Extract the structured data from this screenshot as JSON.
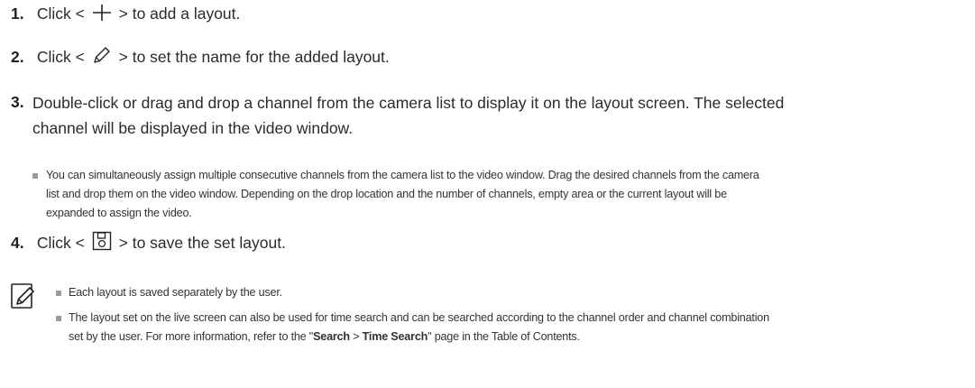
{
  "steps": [
    {
      "number": "1.",
      "before": "Click <",
      "after": "> to add a layout.",
      "icon": "plus-icon"
    },
    {
      "number": "2.",
      "before": "Click <",
      "after": "> to set the name for the added layout.",
      "icon": "pencil-icon"
    },
    {
      "number": "3.",
      "line1": "Double-click or drag and drop a channel from the camera list to display it on the layout screen. The selected",
      "line2": "channel will be displayed in the video window."
    },
    {
      "number": "4.",
      "before": "Click <",
      "after": "> to save the set layout.",
      "icon": "save-layout-icon"
    }
  ],
  "step3_note": {
    "line1": "You can simultaneously assign multiple consecutive channels from the camera list to the video window. Drag the desired channels from the camera",
    "line2": "list and drop them on the video window. Depending on the drop location and the number of channels, empty area or the current layout will be",
    "line3": "expanded to assign the video."
  },
  "memo": {
    "icon": "memo-pencil-icon",
    "note1": "Each layout is saved separately by the user.",
    "note2_line1": "The layout set on the live screen can also be used for time search and can be searched according to the channel order and channel combination",
    "note2_line2_before": "set by the user. For more information, refer to the \"",
    "note2_bold1": "Search",
    "note2_sep": " > ",
    "note2_bold2": "Time Search",
    "note2_line2_after": "\" page in the Table of Contents."
  }
}
